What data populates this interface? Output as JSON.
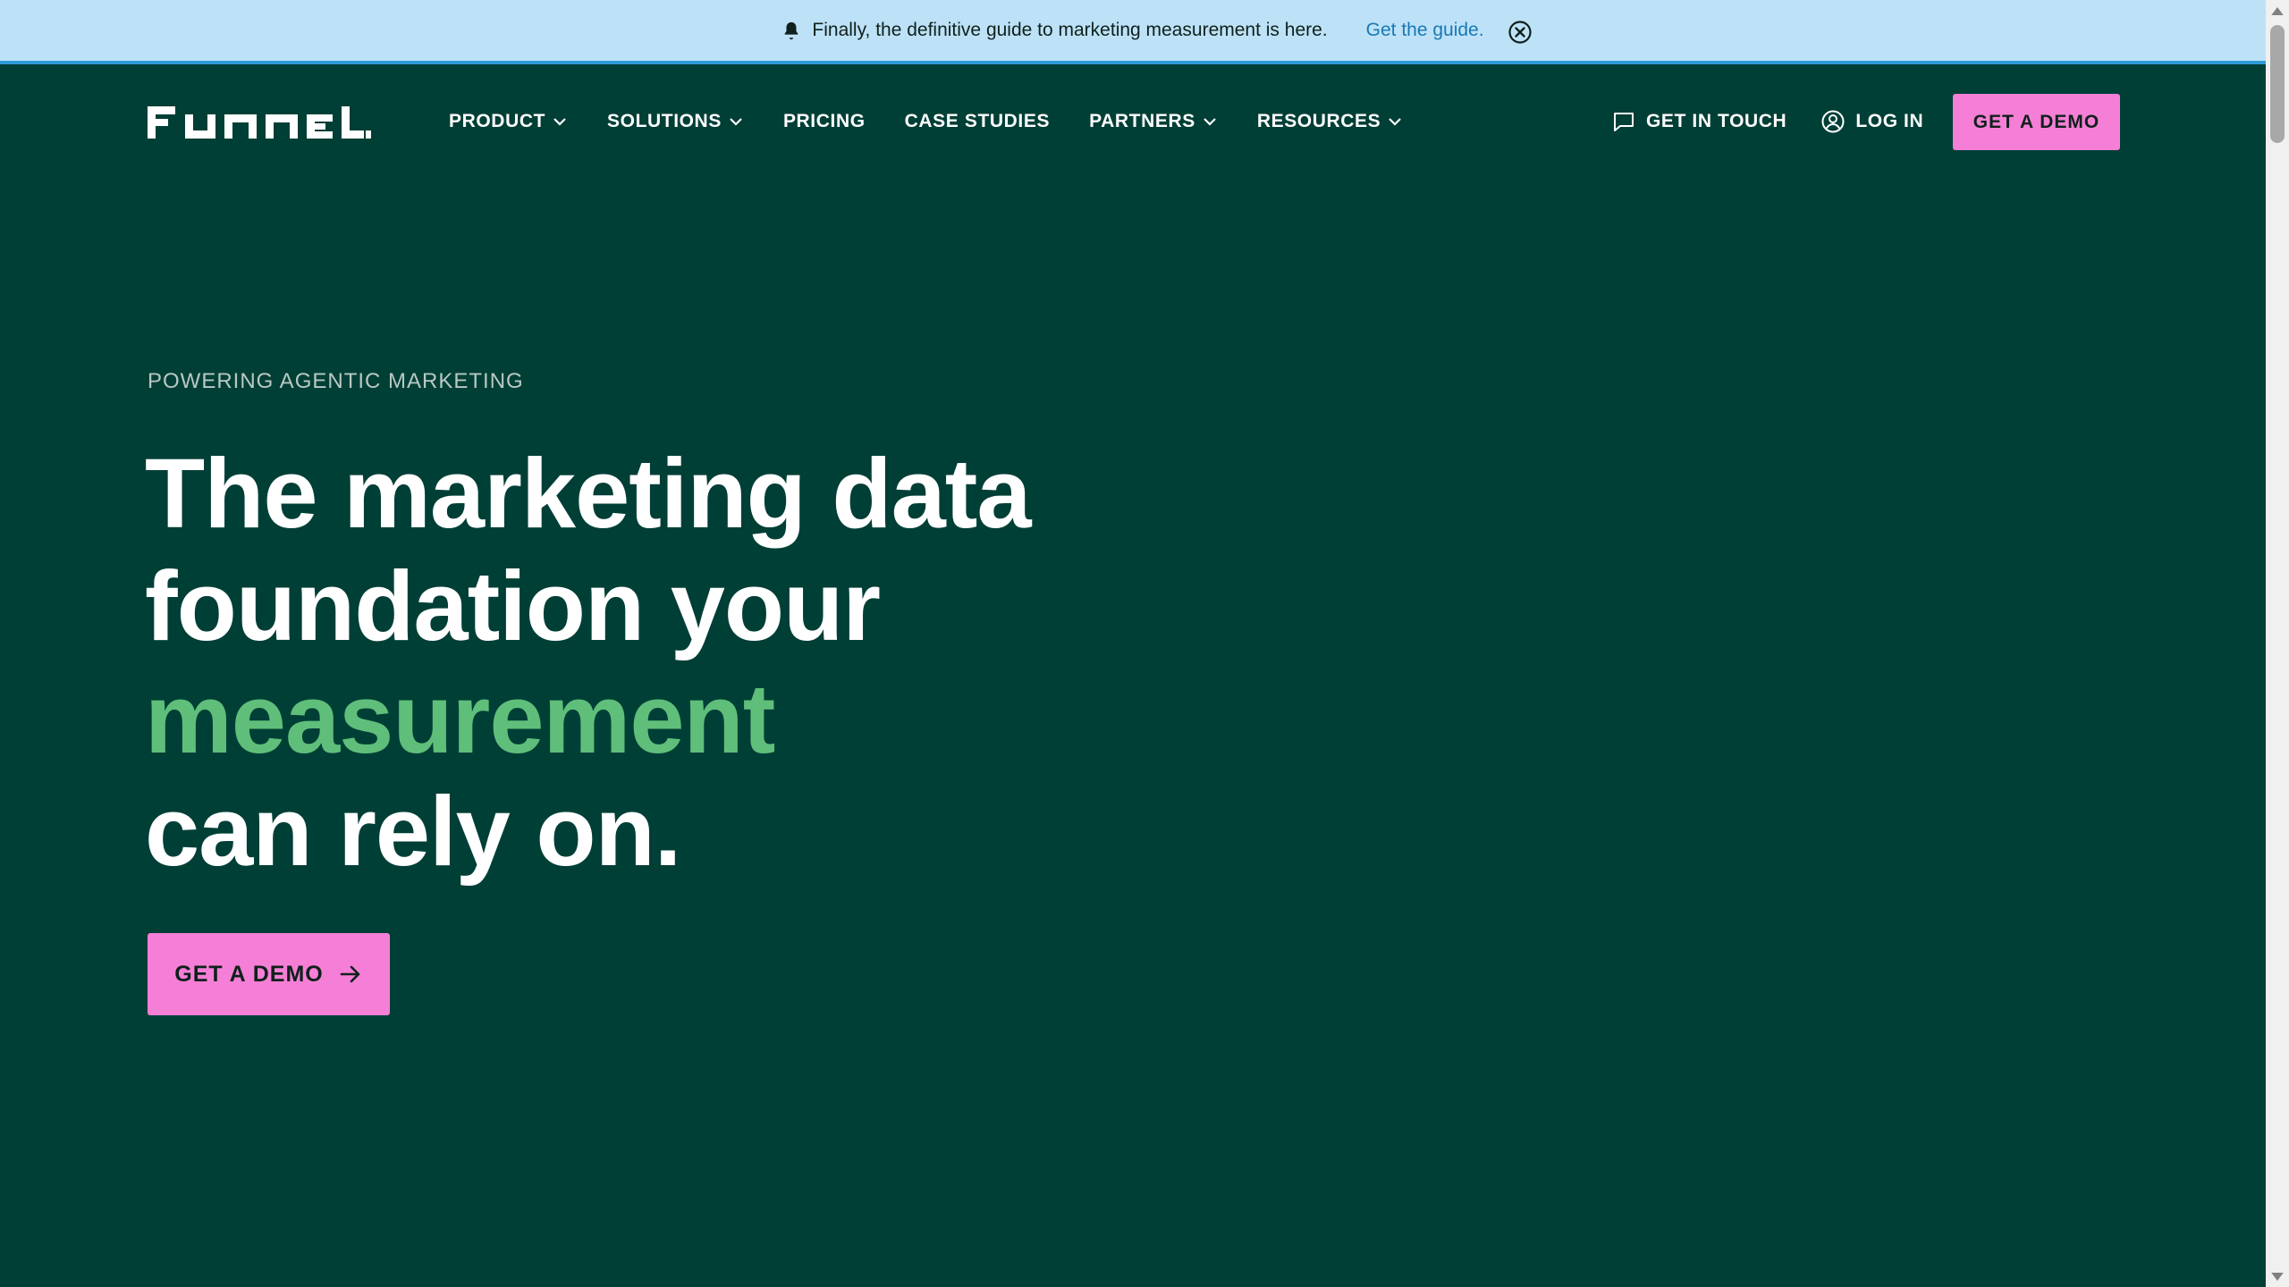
{
  "banner": {
    "message": "Finally, the definitive guide to marketing measurement is here.",
    "link_text": "Get the guide.",
    "icon": "bell-icon",
    "close_icon": "close-circle-icon"
  },
  "header": {
    "logo_text": "FUNNEL",
    "nav": [
      {
        "label": "PRODUCT",
        "dropdown": true
      },
      {
        "label": "SOLUTIONS",
        "dropdown": true
      },
      {
        "label": "PRICING",
        "dropdown": false
      },
      {
        "label": "CASE STUDIES",
        "dropdown": false
      },
      {
        "label": "PARTNERS",
        "dropdown": true
      },
      {
        "label": "RESOURCES",
        "dropdown": true
      }
    ],
    "get_in_touch": "GET IN TOUCH",
    "log_in": "LOG IN",
    "demo_button": "GET A DEMO"
  },
  "hero": {
    "eyebrow": "POWERING AGENTIC MARKETING",
    "headline_line1": "The marketing data",
    "headline_line2": "foundation your",
    "headline_highlight": "measurement",
    "headline_line4": "can rely on.",
    "cta": "GET A DEMO"
  },
  "colors": {
    "background": "#003f36",
    "banner": "#bde2f7",
    "accent_pink": "#f57fd6",
    "highlight_green": "#5fbf7a"
  }
}
